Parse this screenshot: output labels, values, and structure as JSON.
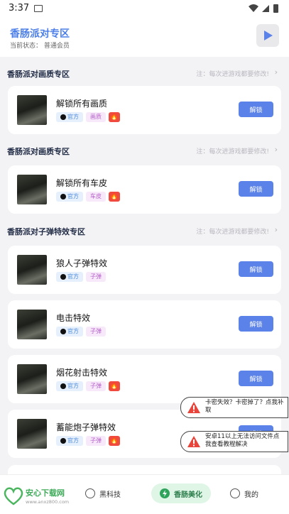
{
  "status_bar": {
    "time": "3:37"
  },
  "header": {
    "title": "香肠派对专区",
    "status": "当前状态：  普通会员"
  },
  "sections": [
    {
      "title": "香肠派对画质专区",
      "note": "注：每次进游戏都要修改!"
    },
    {
      "title": "香肠派对画质专区",
      "note": "注：每次进游戏都要修改!"
    },
    {
      "title": "香肠派对子弹特效专区",
      "note": "注：每次进游戏都要修改!"
    }
  ],
  "cards": [
    {
      "name": "解锁所有画质",
      "tag1": "官方",
      "tag2": "画质",
      "fire": true,
      "button": "解锁"
    },
    {
      "name": "解锁所有车皮",
      "tag1": "官方",
      "tag2": "车皮",
      "fire": true,
      "button": "解锁"
    },
    {
      "name": "狼人子弹特效",
      "tag1": "官方",
      "tag2": "子弹",
      "fire": false,
      "button": "解锁"
    },
    {
      "name": "电击特效",
      "tag1": "官方",
      "tag2": "子弹",
      "fire": false,
      "button": "解锁"
    },
    {
      "name": "烟花射击特效",
      "tag1": "官方",
      "tag2": "子弹",
      "fire": true,
      "button": "解锁"
    },
    {
      "name": "蓄能炮子弹特效",
      "tag1": "官方",
      "tag2": "子弹",
      "fire": true,
      "button": "解锁"
    }
  ],
  "toasts": [
    "卡密失效？卡密掉了？点我补取",
    "安卓11以上无法访问文件点我查看教程解决"
  ],
  "nav": {
    "item1": "黑科技",
    "item2": "香肠美化",
    "item3": "我的"
  },
  "watermark": {
    "name": "安心下载网",
    "url": "www.anxz800.com"
  },
  "colors": {
    "accent": "#5b82e8",
    "title": "#4d7fe8",
    "fire": "#f04a3e",
    "nav_active": "#dff5e6"
  }
}
